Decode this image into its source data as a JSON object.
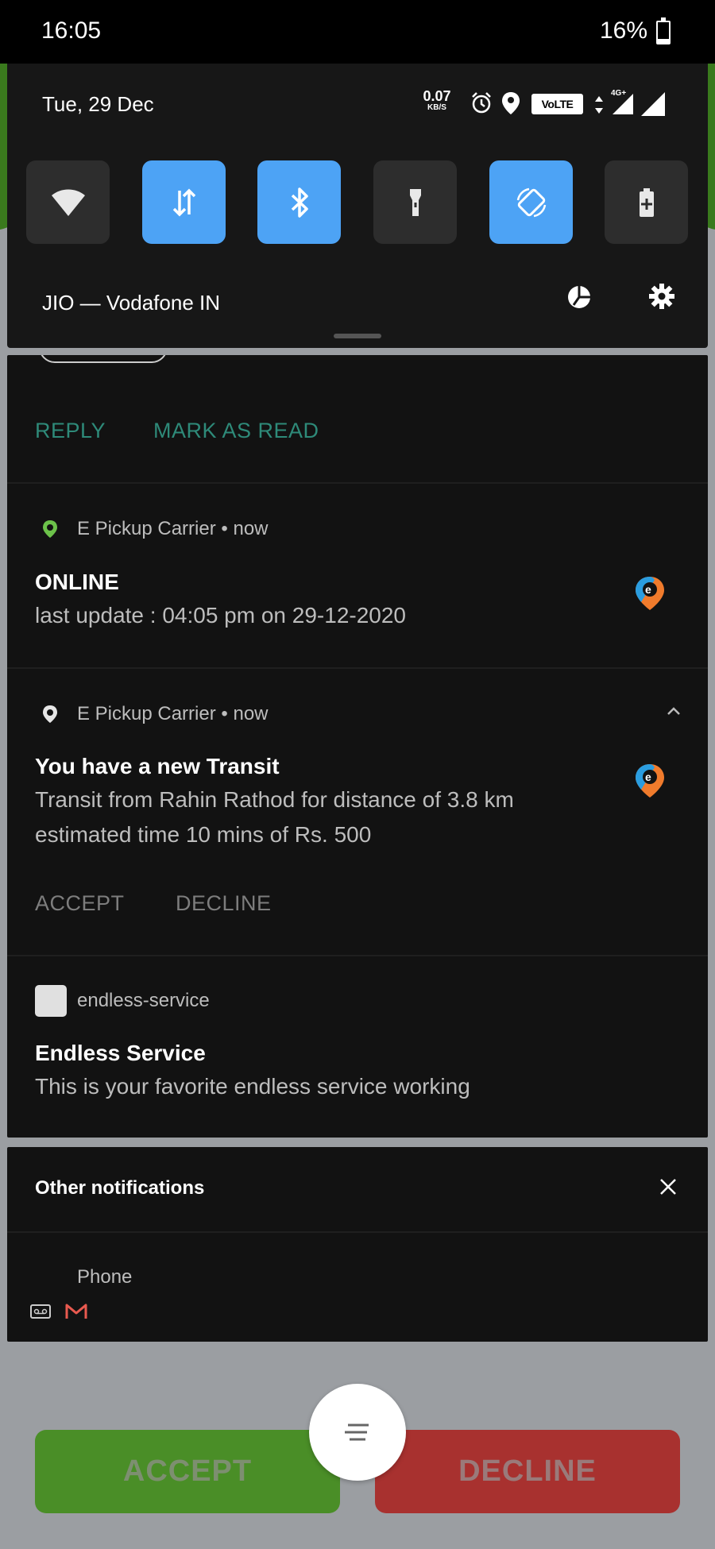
{
  "status_bar": {
    "time": "16:05",
    "battery": "16%"
  },
  "quick_settings": {
    "date": "Tue, 29 Dec",
    "net_speed_value": "0.07",
    "net_speed_unit": "KB/S",
    "volte": "VoLTE",
    "network_type": "4G+",
    "carrier": "JIO — Vodafone IN",
    "tiles": [
      {
        "name": "wifi",
        "on": false
      },
      {
        "name": "mobile-data",
        "on": true
      },
      {
        "name": "bluetooth",
        "on": true
      },
      {
        "name": "flashlight",
        "on": false
      },
      {
        "name": "auto-rotate",
        "on": true
      },
      {
        "name": "battery-saver",
        "on": false
      }
    ],
    "accent_color": "#4da3f5"
  },
  "message_actions": {
    "reply": "REPLY",
    "mark_as_read": "MARK AS READ"
  },
  "notifications": [
    {
      "app": "E Pickup Carrier",
      "time": "now",
      "title": "ONLINE",
      "body": "last update : 04:05 pm on 29-12-2020"
    },
    {
      "app": "E Pickup Carrier",
      "time": "now",
      "title": "You have a new Transit",
      "body": "Transit from Rahin Rathod for distance of 3.8 km estimated time 10 mins of Rs. 500",
      "actions": [
        "ACCEPT",
        "DECLINE"
      ]
    },
    {
      "app": "endless-service",
      "title": "Endless Service",
      "body": "This is your favorite endless service working"
    }
  ],
  "other_notifications": {
    "title": "Other notifications",
    "app": "Phone"
  },
  "background_app": {
    "accept": "ACCEPT",
    "decline": "DECLINE"
  },
  "separator": "•"
}
